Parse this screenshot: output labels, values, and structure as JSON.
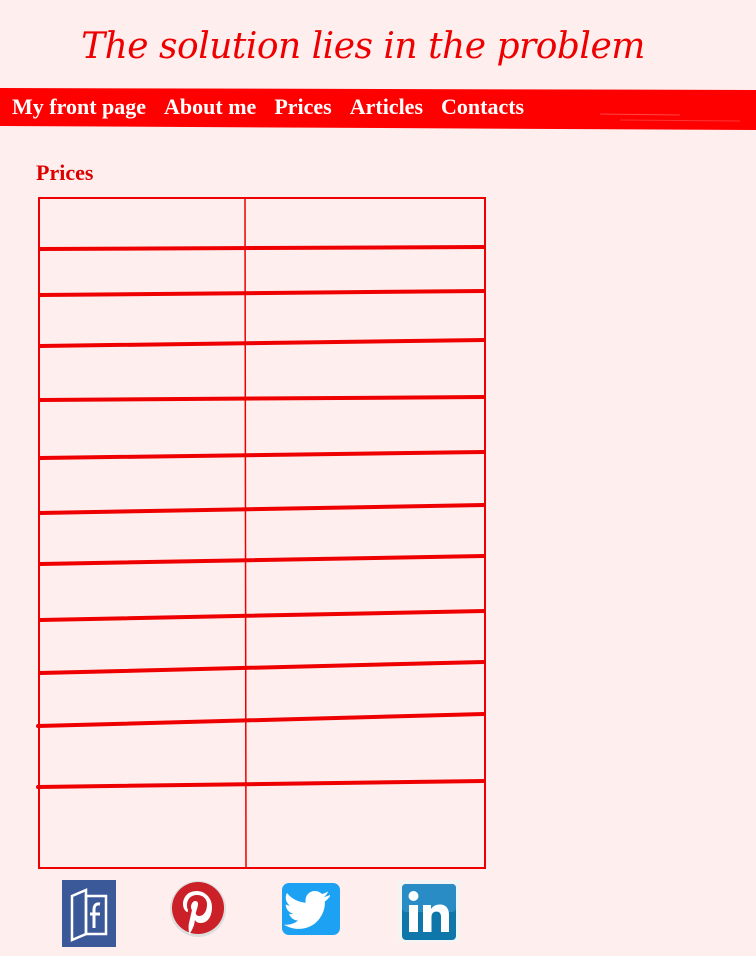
{
  "site": {
    "title": "The solution lies in the problem"
  },
  "nav": {
    "items": [
      {
        "label": "My front page"
      },
      {
        "label": "About me"
      },
      {
        "label": "Prices"
      },
      {
        "label": "Articles"
      },
      {
        "label": "Contacts"
      }
    ]
  },
  "main": {
    "heading": "Prices",
    "table": {
      "columns": 2,
      "rows": 13,
      "cells": [
        [
          "",
          ""
        ],
        [
          "",
          ""
        ],
        [
          "",
          ""
        ],
        [
          "",
          ""
        ],
        [
          "",
          ""
        ],
        [
          "",
          ""
        ],
        [
          "",
          ""
        ],
        [
          "",
          ""
        ],
        [
          "",
          ""
        ],
        [
          "",
          ""
        ],
        [
          "",
          ""
        ],
        [
          "",
          ""
        ],
        [
          "",
          ""
        ]
      ]
    }
  },
  "social": {
    "links": [
      {
        "icon": "facebook-icon"
      },
      {
        "icon": "pinterest-icon"
      },
      {
        "icon": "twitter-icon"
      },
      {
        "icon": "linkedin-icon"
      }
    ]
  },
  "colors": {
    "background": "#ffeeee",
    "accent": "#ee0000",
    "nav_text": "#ffffff",
    "facebook": "#3b5998",
    "pinterest": "#cb2027",
    "twitter": "#1da1f2",
    "linkedin": "#0e76a8"
  }
}
